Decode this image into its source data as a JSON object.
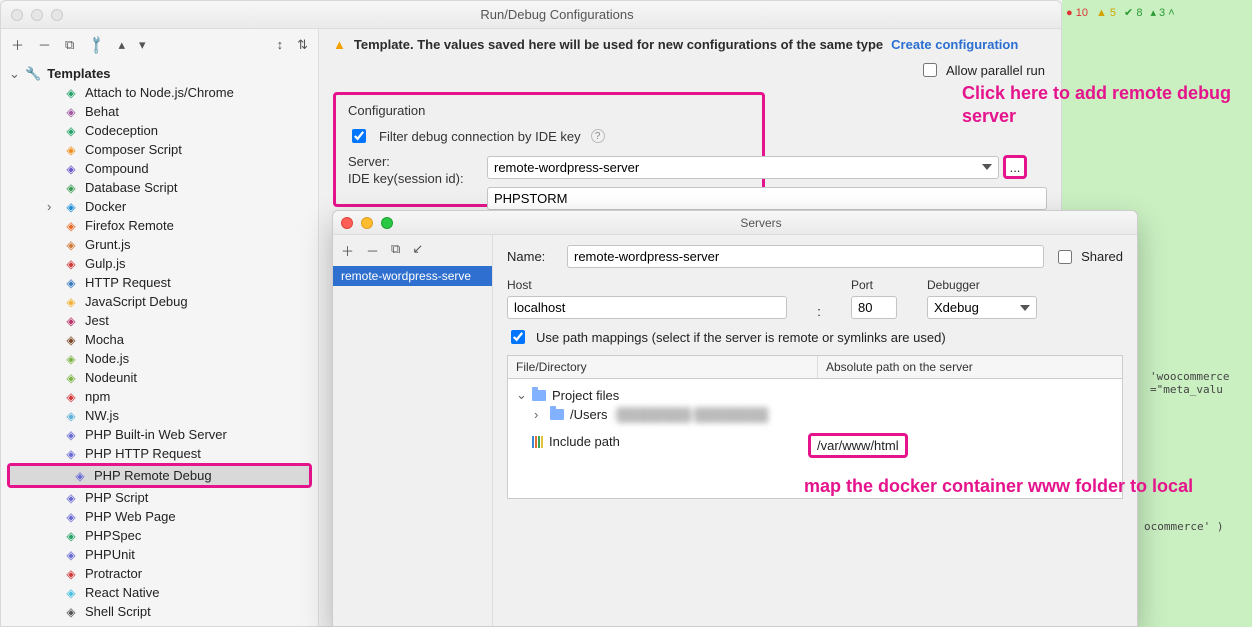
{
  "window": {
    "title": "Run/Debug Configurations"
  },
  "badges": {
    "errors": "10",
    "warnings": "5",
    "weak": "8",
    "info": "3"
  },
  "template_banner": {
    "text": "Template. The values saved here will be used for new configurations of the same type",
    "link": "Create configuration"
  },
  "allow_parallel_label": "Allow parallel run",
  "config": {
    "legend": "Configuration",
    "filter_label": "Filter debug connection by IDE key",
    "server_label": "Server:",
    "server_value": "remote-wordpress-server",
    "idekey_label": "IDE key(session id):",
    "idekey_value": "PHPSTORM",
    "dots": "..."
  },
  "tree": {
    "root": "Templates",
    "items": [
      "Attach to Node.js/Chrome",
      "Behat",
      "Codeception",
      "Composer Script",
      "Compound",
      "Database Script",
      "Docker",
      "Firefox Remote",
      "Grunt.js",
      "Gulp.js",
      "HTTP Request",
      "JavaScript Debug",
      "Jest",
      "Mocha",
      "Node.js",
      "Nodeunit",
      "npm",
      "NW.js",
      "PHP Built-in Web Server",
      "PHP HTTP Request",
      "PHP Remote Debug",
      "PHP Script",
      "PHP Web Page",
      "PHPSpec",
      "PHPUnit",
      "Protractor",
      "React Native",
      "Shell Script"
    ],
    "selected_index": 20,
    "expandable_indices": [
      6
    ]
  },
  "icons": {
    "colors": [
      "#28a36a",
      "#a05aa0",
      "#28a36a",
      "#f28c1a",
      "#6a5acd",
      "#3b9c56",
      "#1f8dd6",
      "#e86c28",
      "#d07a3a",
      "#d33a3a",
      "#3c7bbf",
      "#f2b134",
      "#b9336a",
      "#7c4a2a",
      "#7cb342",
      "#7cb342",
      "#d33a3a",
      "#5ab0d6",
      "#6a6ad6",
      "#6a6ad6",
      "#6a6ad6",
      "#6a6ad6",
      "#6a6ad6",
      "#28a36a",
      "#6a6ad6",
      "#d33a3a",
      "#4ac1e0",
      "#555555"
    ]
  },
  "annotations": {
    "add_server": "Click here to add remote debug server",
    "map_folder": "map the docker container www folder to local"
  },
  "servers": {
    "title": "Servers",
    "selected": "remote-wordpress-serve",
    "name_label": "Name:",
    "name_value": "remote-wordpress-server",
    "shared_label": "Shared",
    "host_label": "Host",
    "host_value": "localhost",
    "port_label": "Port",
    "port_value": "80",
    "colon": ":",
    "debugger_label": "Debugger",
    "debugger_value": "Xdebug",
    "use_mappings_label": "Use path mappings (select if the server is remote or symlinks are used)",
    "col_file": "File/Directory",
    "col_abs": "Absolute path on the server",
    "project_files": "Project files",
    "users_path": "/Users",
    "include_path": "Include path",
    "abs_path_value": "/var/www/html"
  },
  "bg_code": {
    "line1": "'woocommerce\n=\"meta_valu",
    "line2": "ocommerce' )"
  }
}
